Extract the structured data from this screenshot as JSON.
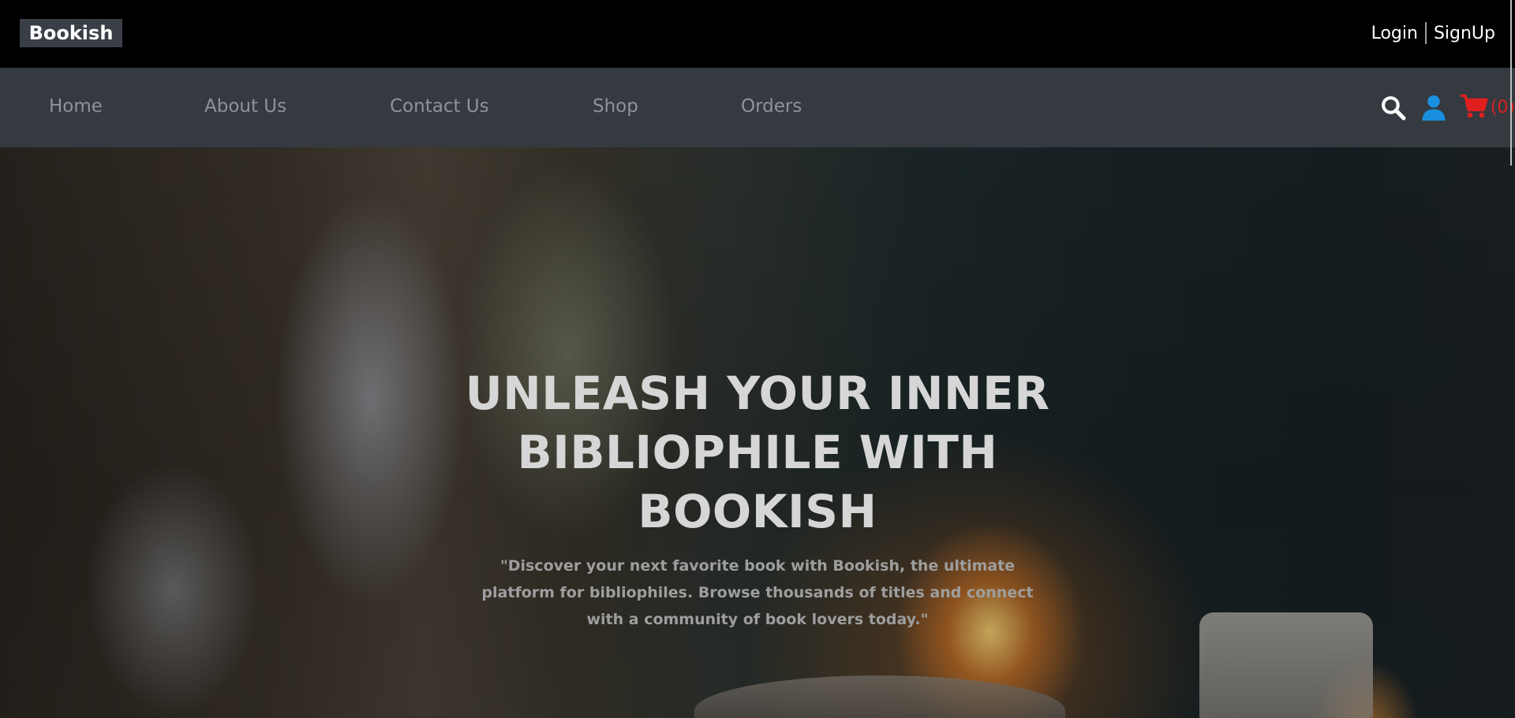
{
  "header": {
    "brand": "Bookish",
    "login_label": "Login",
    "signup_label": "SignUp"
  },
  "nav": {
    "items": [
      {
        "label": "Home"
      },
      {
        "label": "About Us"
      },
      {
        "label": "Contact Us"
      },
      {
        "label": "Shop"
      },
      {
        "label": "Orders"
      }
    ],
    "icons": {
      "search": "search-icon",
      "user": "user-icon",
      "cart": "cart-icon"
    },
    "cart_count": "(0)"
  },
  "hero": {
    "title": "UNLEASH YOUR INNER BIBLIOPHILE WITH BOOKISH",
    "subtitle": "\"Discover your next favorite book with Bookish, the ultimate platform for bibliophiles. Browse thousands of titles and connect with a community of book lovers today.\""
  },
  "colors": {
    "topbar_bg": "#000000",
    "navbar_bg": "#343a40",
    "nav_text": "#8e9399",
    "user_icon": "#1a8fe0",
    "cart_icon": "#e01f1f"
  }
}
